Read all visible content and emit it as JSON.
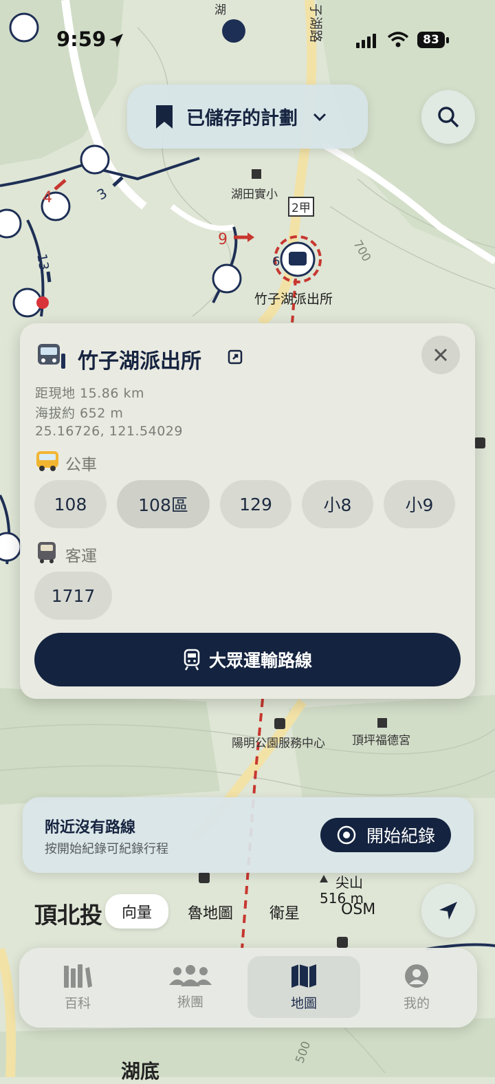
{
  "status_bar": {
    "time": "9:59",
    "battery": "83"
  },
  "plan_selector": {
    "label": "已儲存的計劃"
  },
  "map_labels": {
    "school": "湖田實小",
    "road_shield": "2甲",
    "contour_700": "700",
    "contour_500": "500",
    "stop_name": "竹子湖派出所",
    "visitor_center": "陽明公園服務中心",
    "temple": "頂坪福德宮",
    "peak_name": "尖山",
    "peak_elev": "516 m",
    "top_label": "湖",
    "road_label": "子湖路",
    "area_label": "頂北投",
    "bottom_label": "湖底",
    "waypoint_numbers": [
      "3",
      "4",
      "9",
      "13",
      "6"
    ]
  },
  "stop_card": {
    "title": "竹子湖派出所",
    "distance": "距現地 15.86 km",
    "altitude": "海拔約 652 m",
    "coords": "25.16726, 121.54029",
    "bus_section": "公車",
    "bus_routes": [
      "108",
      "108區",
      "129",
      "小8",
      "小9"
    ],
    "coach_section": "客運",
    "coach_routes": [
      "1717"
    ],
    "transit_button": "大眾運輸路線"
  },
  "route_card": {
    "title": "附近沒有路線",
    "subtitle": "按開始紀錄可紀錄行程",
    "start_button": "開始紀錄"
  },
  "layers": {
    "options": [
      "向量",
      "魯地圖",
      "衛星",
      "OSM"
    ],
    "selected": "向量"
  },
  "tabs": [
    {
      "label": "百科",
      "icon": "library-icon"
    },
    {
      "label": "揪團",
      "icon": "group-icon"
    },
    {
      "label": "地圖",
      "icon": "map-icon",
      "active": true
    },
    {
      "label": "我的",
      "icon": "profile-icon"
    }
  ],
  "colors": {
    "navy": "#14233f",
    "route_red": "#c7372f",
    "map_bg": "#dfe6d6"
  }
}
